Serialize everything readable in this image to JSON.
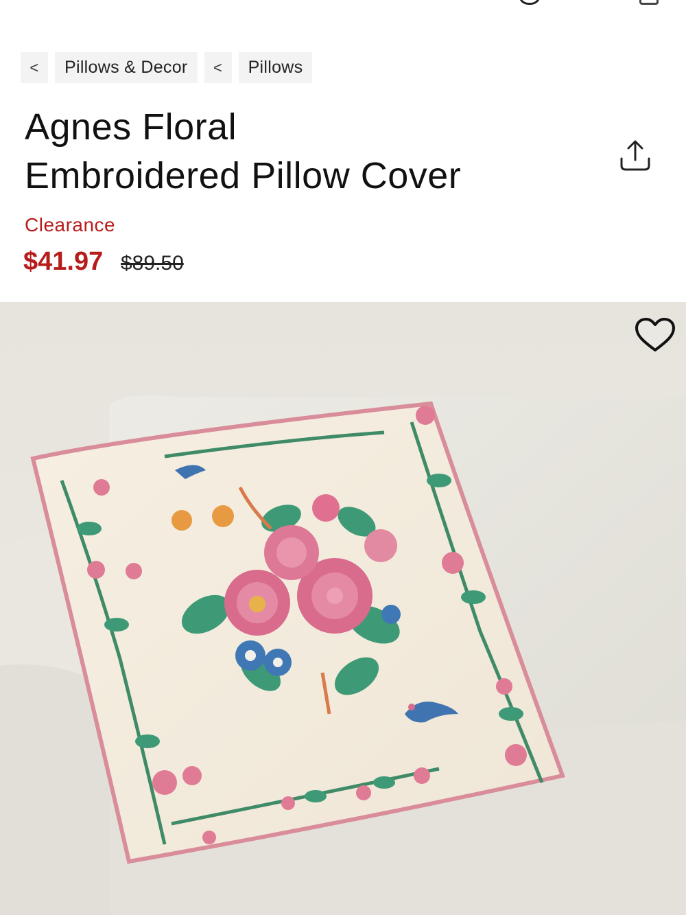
{
  "breadcrumb": {
    "back_glyph": "<",
    "items": [
      {
        "label": "Pillows & Decor"
      },
      {
        "label": "Pillows"
      }
    ]
  },
  "product": {
    "title_line1": "Agnes Floral",
    "title_line2": "Embroidered Pillow Cover",
    "badge": "Clearance",
    "sale_price": "$41.97",
    "original_price": "$89.50"
  },
  "icons": {
    "share": "share-icon",
    "favorite": "heart-icon"
  },
  "colors": {
    "sale_red": "#b71c1c",
    "crumb_bg": "#f3f3f3"
  }
}
